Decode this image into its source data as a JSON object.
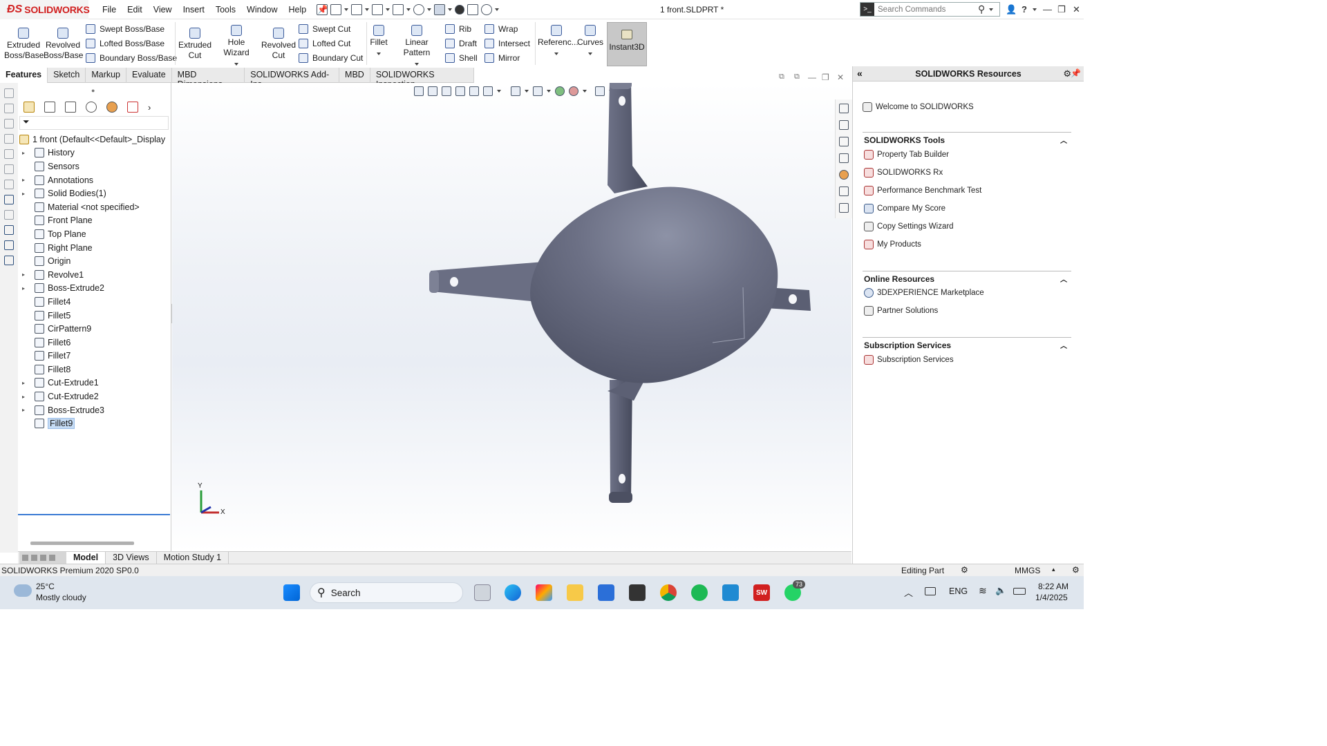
{
  "app": {
    "brand": "SOLIDWORKS",
    "document_title": "1 front.SLDPRT *",
    "menus": [
      "File",
      "Edit",
      "View",
      "Insert",
      "Tools",
      "Window",
      "Help"
    ],
    "search_placeholder": "Search Commands",
    "accent_red": "#d12020",
    "selection_blue": "#3b7bd4"
  },
  "command_manager": {
    "extruded_boss": [
      "Extruded",
      "Boss/Base"
    ],
    "revolved_boss": [
      "Revolved",
      "Boss/Base"
    ],
    "swept_boss": "Swept Boss/Base",
    "lofted_boss": "Lofted Boss/Base",
    "boundary_boss": "Boundary Boss/Base",
    "extruded_cut": [
      "Extruded",
      "Cut"
    ],
    "hole_wizard": "Hole Wizard",
    "revolved_cut": [
      "Revolved",
      "Cut"
    ],
    "swept_cut": "Swept Cut",
    "lofted_cut": "Lofted Cut",
    "boundary_cut": "Boundary Cut",
    "fillet": "Fillet",
    "linear_pattern": "Linear Pattern",
    "rib": "Rib",
    "draft": "Draft",
    "shell": "Shell",
    "wrap": "Wrap",
    "intersect": "Intersect",
    "mirror": "Mirror",
    "reference": "Referenc...",
    "curves": "Curves",
    "instant3d": "Instant3D"
  },
  "tabs": [
    "Features",
    "Sketch",
    "Markup",
    "Evaluate",
    "MBD Dimensions",
    "SOLIDWORKS Add-Ins",
    "MBD",
    "SOLIDWORKS Inspection"
  ],
  "feature_tree": {
    "root": "1 front  (Default<<Default>_Display",
    "items": [
      {
        "label": "History",
        "arrow": true
      },
      {
        "label": "Sensors",
        "arrow": false
      },
      {
        "label": "Annotations",
        "arrow": true
      },
      {
        "label": "Solid Bodies(1)",
        "arrow": true
      },
      {
        "label": "Material <not specified>",
        "arrow": false
      },
      {
        "label": "Front Plane",
        "arrow": false
      },
      {
        "label": "Top Plane",
        "arrow": false
      },
      {
        "label": "Right Plane",
        "arrow": false
      },
      {
        "label": "Origin",
        "arrow": false
      },
      {
        "label": "Revolve1",
        "arrow": true
      },
      {
        "label": "Boss-Extrude2",
        "arrow": true
      },
      {
        "label": "Fillet4",
        "arrow": false
      },
      {
        "label": "Fillet5",
        "arrow": false
      },
      {
        "label": "CirPattern9",
        "arrow": false
      },
      {
        "label": "Fillet6",
        "arrow": false
      },
      {
        "label": "Fillet7",
        "arrow": false
      },
      {
        "label": "Fillet8",
        "arrow": false
      },
      {
        "label": "Cut-Extrude1",
        "arrow": true
      },
      {
        "label": "Cut-Extrude2",
        "arrow": true
      },
      {
        "label": "Boss-Extrude3",
        "arrow": true
      },
      {
        "label": "Fillet9",
        "arrow": false,
        "selected": true
      }
    ]
  },
  "triad": {
    "y": "Y",
    "x": "X"
  },
  "bottom_tabs": [
    "Model",
    "3D Views",
    "Motion Study 1"
  ],
  "status": {
    "left": "SOLIDWORKS Premium 2020 SP0.0",
    "mode": "Editing Part",
    "units": "MMGS"
  },
  "task_pane": {
    "title": "SOLIDWORKS Resources",
    "welcome": "Welcome to SOLIDWORKS",
    "tools_header": "SOLIDWORKS Tools",
    "tools": [
      "Property Tab Builder",
      "SOLIDWORKS Rx",
      "Performance Benchmark Test",
      "Compare My Score",
      "Copy Settings Wizard",
      "My Products"
    ],
    "online_header": "Online Resources",
    "online": [
      "3DEXPERIENCE Marketplace",
      "Partner Solutions"
    ],
    "subs_header": "Subscription Services",
    "subs": [
      "Subscription Services"
    ]
  },
  "taskbar": {
    "temp": "25°C",
    "weather": "Mostly cloudy",
    "search": "Search",
    "lang": "ENG",
    "time": "8:22 AM",
    "date": "1/4/2025",
    "badge": "73",
    "sw_badge": "SW"
  }
}
